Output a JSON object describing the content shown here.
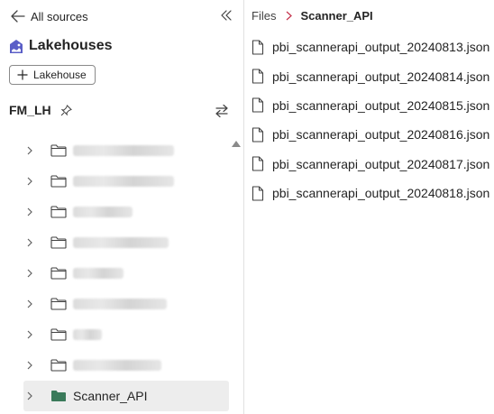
{
  "nav": {
    "back_label": "All sources"
  },
  "section": {
    "title": "Lakehouses",
    "add_button_label": "Lakehouse"
  },
  "lakehouse": {
    "name": "FM_LH"
  },
  "tree": {
    "blurred_items": [
      {
        "width": 112
      },
      {
        "width": 112
      },
      {
        "width": 66
      },
      {
        "width": 106
      },
      {
        "width": 56
      },
      {
        "width": 104
      },
      {
        "width": 32
      },
      {
        "width": 98
      }
    ],
    "selected_item": {
      "label": "Scanner_API",
      "folder_color": "#3a7a5a"
    }
  },
  "breadcrumb": {
    "root": "Files",
    "current": "Scanner_API"
  },
  "files": [
    "pbi_scannerapi_output_20240813.json",
    "pbi_scannerapi_output_20240814.json",
    "pbi_scannerapi_output_20240815.json",
    "pbi_scannerapi_output_20240816.json",
    "pbi_scannerapi_output_20240817.json",
    "pbi_scannerapi_output_20240818.json"
  ],
  "icons": [
    "arrow-left-icon",
    "double-chevron-left-icon",
    "lakehouse-icon",
    "plus-icon",
    "pin-icon",
    "swap-icon",
    "chevron-right-icon",
    "folder-icon",
    "file-icon"
  ],
  "colors": {
    "divider": "#e1e1e1",
    "selected_bg": "#ededed",
    "accent": "#3a7a5a"
  }
}
